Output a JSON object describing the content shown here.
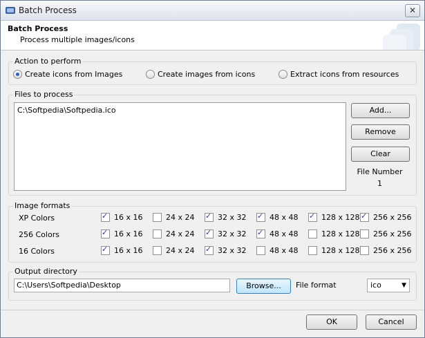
{
  "window": {
    "title": "Batch Process",
    "close_glyph": "✕"
  },
  "header": {
    "title": "Batch Process",
    "subtitle": "Process multiple images/icons"
  },
  "action": {
    "legend": "Action to perform",
    "options": [
      {
        "label": "Create icons from Images",
        "selected": true
      },
      {
        "label": "Create images from icons",
        "selected": false
      },
      {
        "label": "Extract icons from resources",
        "selected": false
      }
    ]
  },
  "files": {
    "legend": "Files to process",
    "items": [
      "C:\\Softpedia\\Softpedia.ico"
    ],
    "add_label": "Add...",
    "remove_label": "Remove",
    "clear_label": "Clear",
    "file_number_label": "File Number",
    "file_number_value": "1"
  },
  "formats": {
    "legend": "Image formats",
    "rows": [
      {
        "label": "XP Colors",
        "cells": [
          {
            "label": "16 x 16",
            "checked": true
          },
          {
            "label": "24 x 24",
            "checked": false
          },
          {
            "label": "32 x 32",
            "checked": true
          },
          {
            "label": "48 x 48",
            "checked": true
          },
          {
            "label": "128 x 128",
            "checked": true
          },
          {
            "label": "256 x 256",
            "checked": true
          }
        ]
      },
      {
        "label": "256 Colors",
        "cells": [
          {
            "label": "16 x 16",
            "checked": true
          },
          {
            "label": "24 x 24",
            "checked": false
          },
          {
            "label": "32 x 32",
            "checked": true
          },
          {
            "label": "48 x 48",
            "checked": true
          },
          {
            "label": "128 x 128",
            "checked": false
          },
          {
            "label": "256 x 256",
            "checked": false
          }
        ]
      },
      {
        "label": "16 Colors",
        "cells": [
          {
            "label": "16 x 16",
            "checked": true
          },
          {
            "label": "24 x 24",
            "checked": false
          },
          {
            "label": "32 x 32",
            "checked": true
          },
          {
            "label": "48 x 48",
            "checked": false
          },
          {
            "label": "128 x 128",
            "checked": false
          },
          {
            "label": "256 x 256",
            "checked": false
          }
        ]
      }
    ]
  },
  "output": {
    "legend": "Output directory",
    "path": "C:\\Users\\Softpedia\\Desktop",
    "browse_label": "Browse...",
    "file_format_label": "File format",
    "file_format_value": "ico"
  },
  "footer": {
    "ok_label": "OK",
    "cancel_label": "Cancel"
  }
}
